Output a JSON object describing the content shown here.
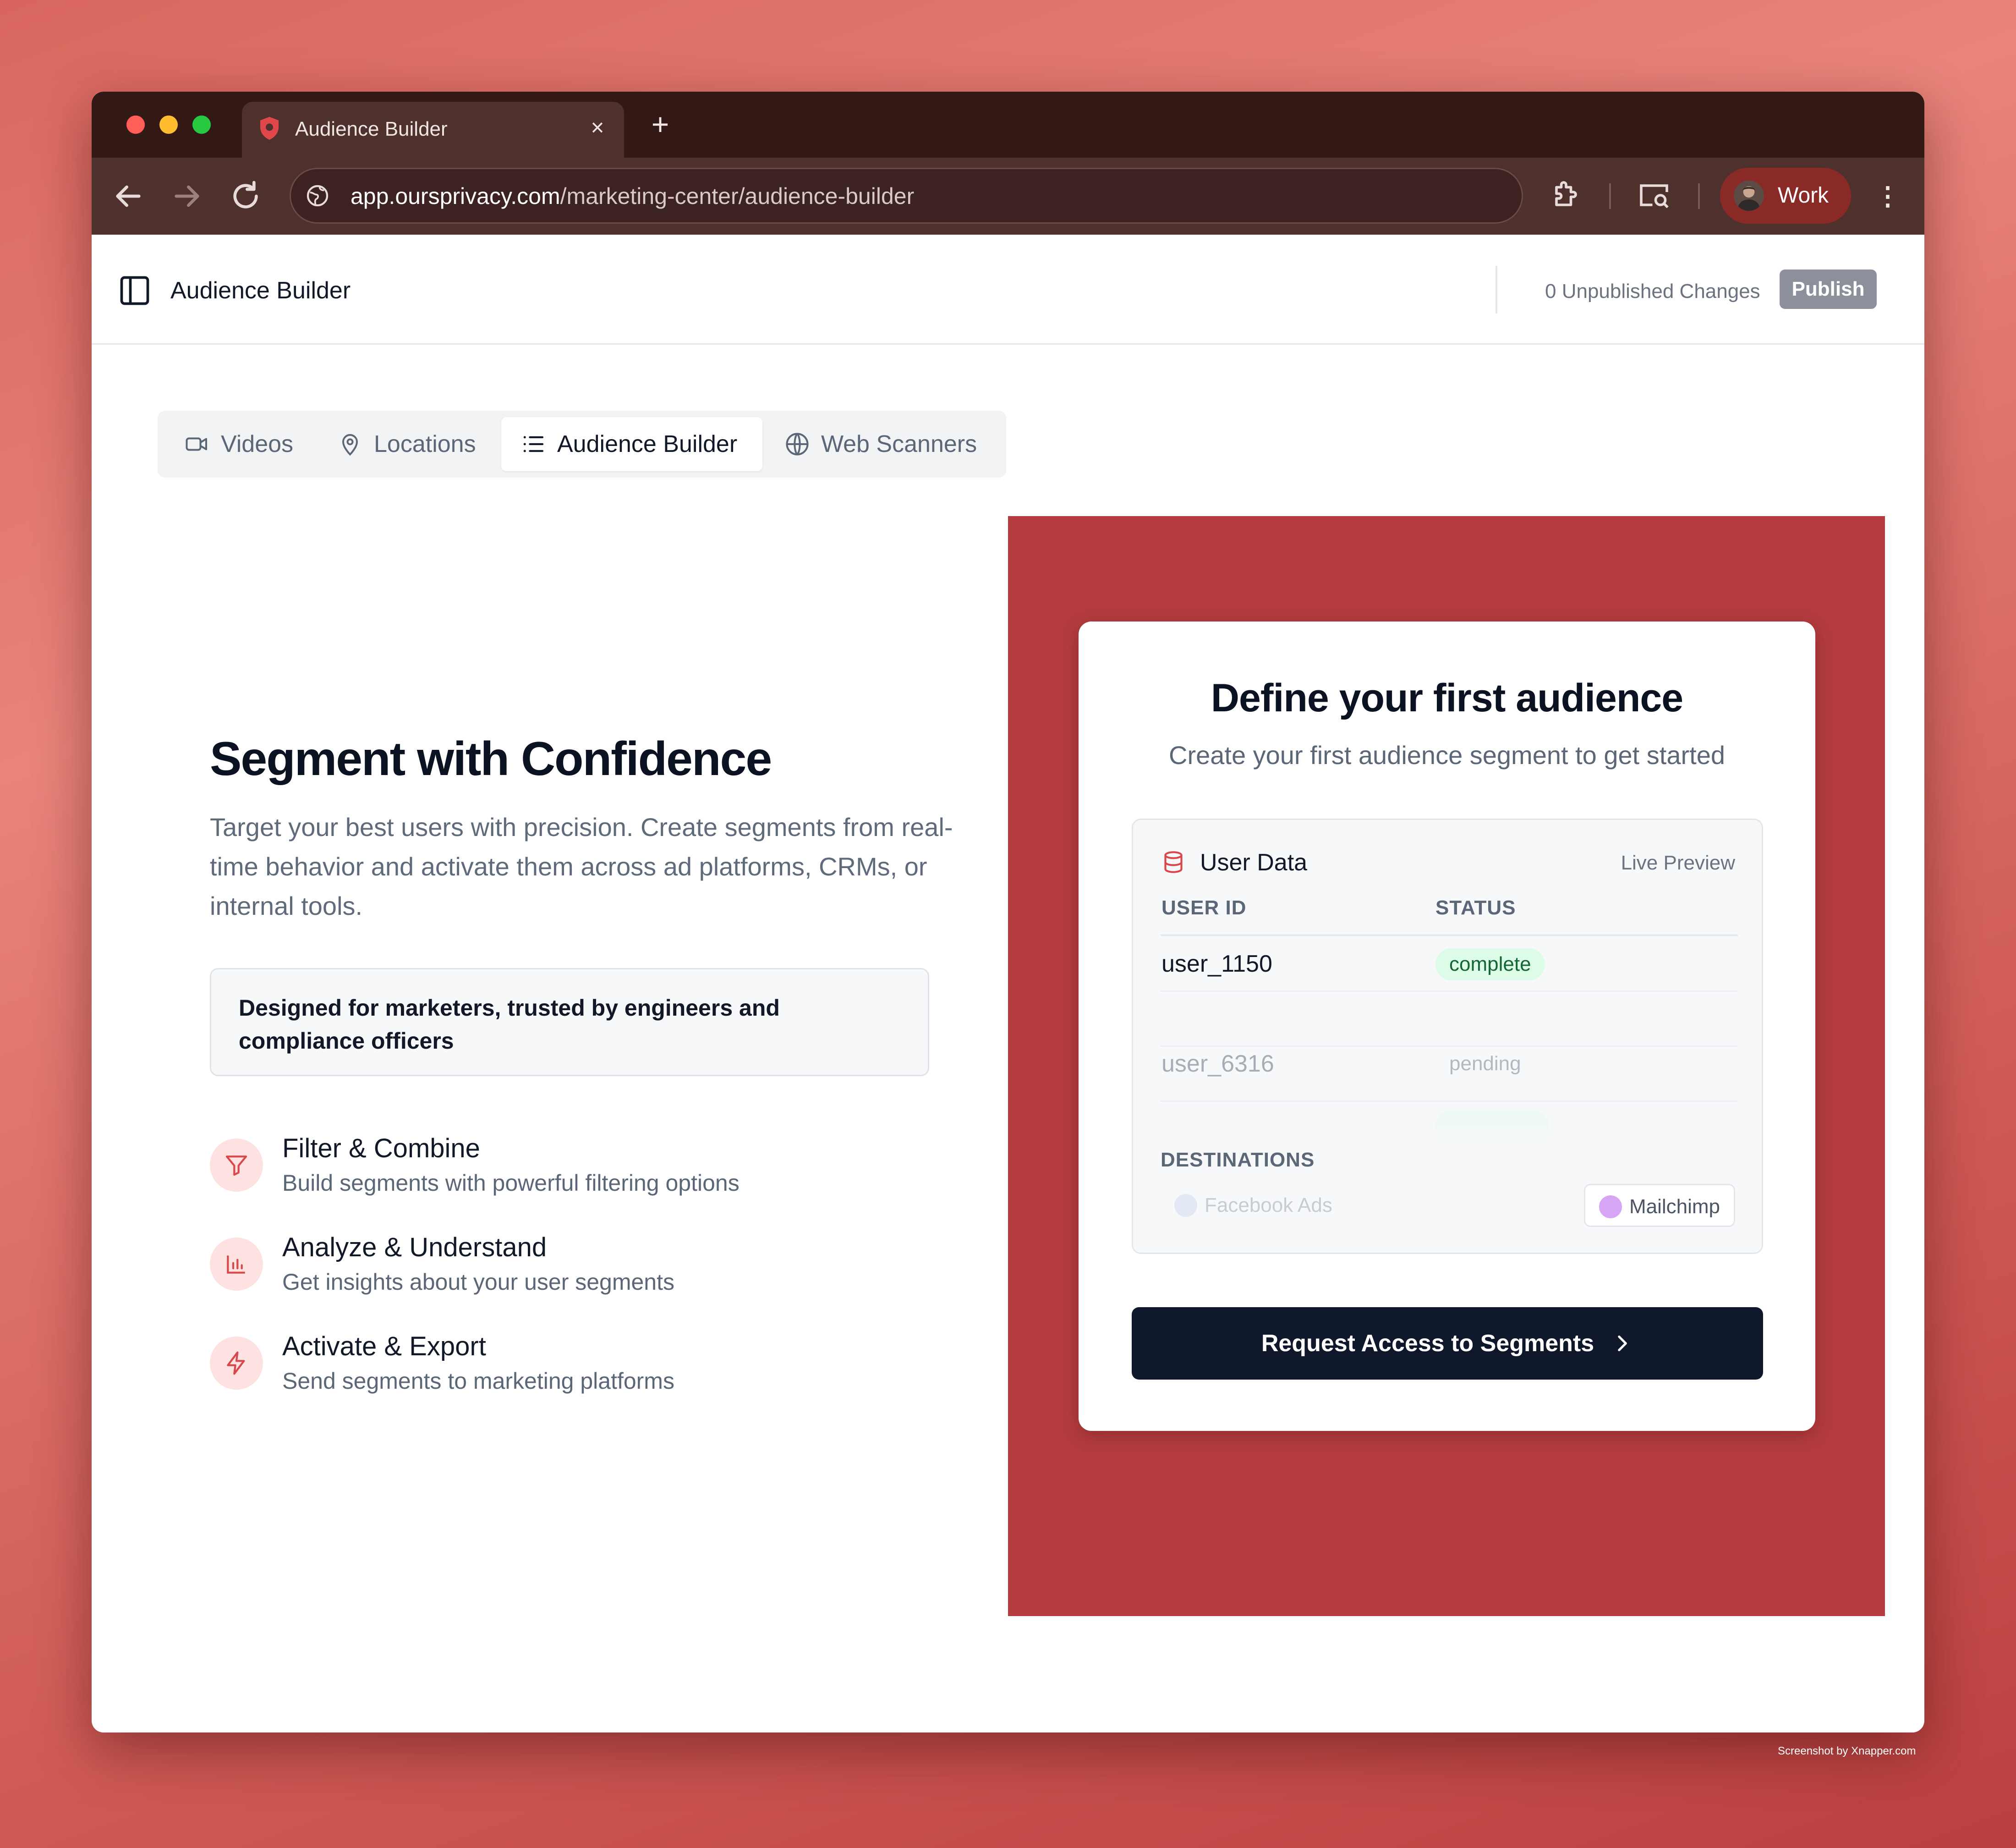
{
  "browser": {
    "tab_title": "Audience Builder",
    "url_host": "app.oursprivacy.com",
    "url_path": "/marketing-center/audience-builder",
    "profile_name": "Work",
    "colors": {
      "close": "#ff5f57",
      "minimize": "#febc2e",
      "maximize": "#28c840"
    }
  },
  "header": {
    "title": "Audience Builder",
    "unpublished": "0 Unpublished Changes",
    "publish_label": "Publish"
  },
  "tabs": [
    {
      "label": "Videos",
      "icon": "video-icon"
    },
    {
      "label": "Locations",
      "icon": "map-pin-icon"
    },
    {
      "label": "Audience Builder",
      "icon": "list-icon",
      "active": true
    },
    {
      "label": "Web Scanners",
      "icon": "globe-icon"
    }
  ],
  "hero": {
    "title": "Segment with Confidence",
    "description": "Target your best users with precision. Create segments from real-time behavior and activate them across ad platforms, CRMs, or internal tools.",
    "callout": "Designed for marketers, trusted by engineers and compliance officers"
  },
  "features": [
    {
      "title": "Filter & Combine",
      "desc": "Build segments with powerful filtering options",
      "icon": "filter-icon"
    },
    {
      "title": "Analyze & Understand",
      "desc": "Get insights about your user segments",
      "icon": "bar-chart-icon"
    },
    {
      "title": "Activate & Export",
      "desc": "Send segments to marketing platforms",
      "icon": "lightning-icon"
    }
  ],
  "card": {
    "title": "Define your first audience",
    "subtitle": "Create your first audience segment to get started",
    "preview": {
      "title": "User Data",
      "live": "Live Preview",
      "columns": [
        "USER ID",
        "STATUS"
      ],
      "rows": [
        {
          "id": "user_1150",
          "status": "complete"
        },
        {
          "id": "user_6316",
          "status": "pending"
        }
      ],
      "destinations_label": "DESTINATIONS",
      "destinations": [
        "Facebook Ads",
        "Mailchimp"
      ]
    },
    "cta": "Request Access to Segments"
  },
  "watermark": "Screenshot by Xnapper.com"
}
